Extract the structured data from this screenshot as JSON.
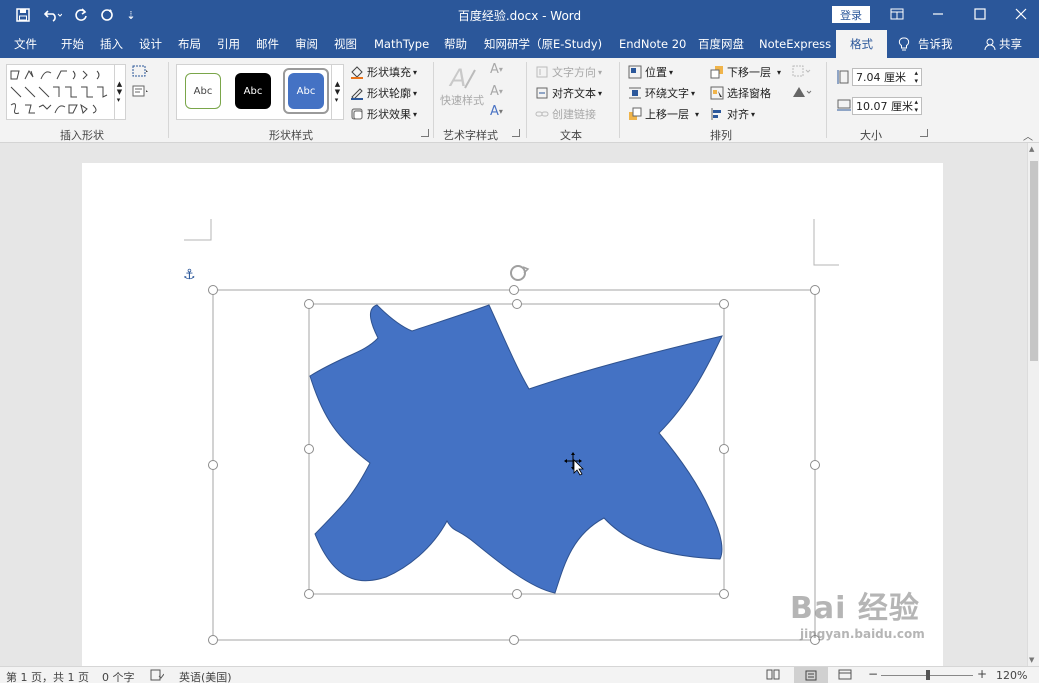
{
  "titlebar": {
    "title": "百度经验.docx - Word",
    "login": "登录",
    "qa_more": "⇣"
  },
  "tabs": [
    "文件",
    "开始",
    "插入",
    "设计",
    "布局",
    "引用",
    "邮件",
    "审阅",
    "视图",
    "MathType",
    "帮助",
    "知网研学（原E-Study)",
    "EndNote 20",
    "百度网盘",
    "NoteExpress",
    "格式"
  ],
  "tell_me": "告诉我",
  "share": "共享",
  "ribbon": {
    "insert_shapes_label": "插入形状",
    "shape_styles_label": "形状样式",
    "art_styles_label": "艺术字样式",
    "text_label": "文本",
    "arrange_label": "排列",
    "size_label": "大小",
    "styles": [
      {
        "text": "Abc"
      },
      {
        "text": "Abc"
      },
      {
        "text": "Abc"
      }
    ],
    "shape_fill": "形状填充",
    "shape_outline": "形状轮廓",
    "shape_effects": "形状效果",
    "quick_styles": "快速样式",
    "text_direction": "文字方向",
    "align_text": "对齐文本",
    "create_link": "创建链接",
    "position": "位置",
    "wrap_text": "环绕文字",
    "bring_forward": "上移一层",
    "send_backward": "下移一层",
    "selection_pane": "选择窗格",
    "align": "对齐",
    "height": "7.04 厘米",
    "width": "10.07 厘米"
  },
  "status": {
    "page": "第 1 页，共 1 页",
    "words": "0 个字",
    "language": "英语(美国)",
    "zoom": "120%"
  },
  "watermark": {
    "brand": "Bai  经验",
    "url": "jingyan.baidu.com"
  },
  "colors": {
    "accent": "#2b579a",
    "shape_fill": "#4472c4"
  }
}
